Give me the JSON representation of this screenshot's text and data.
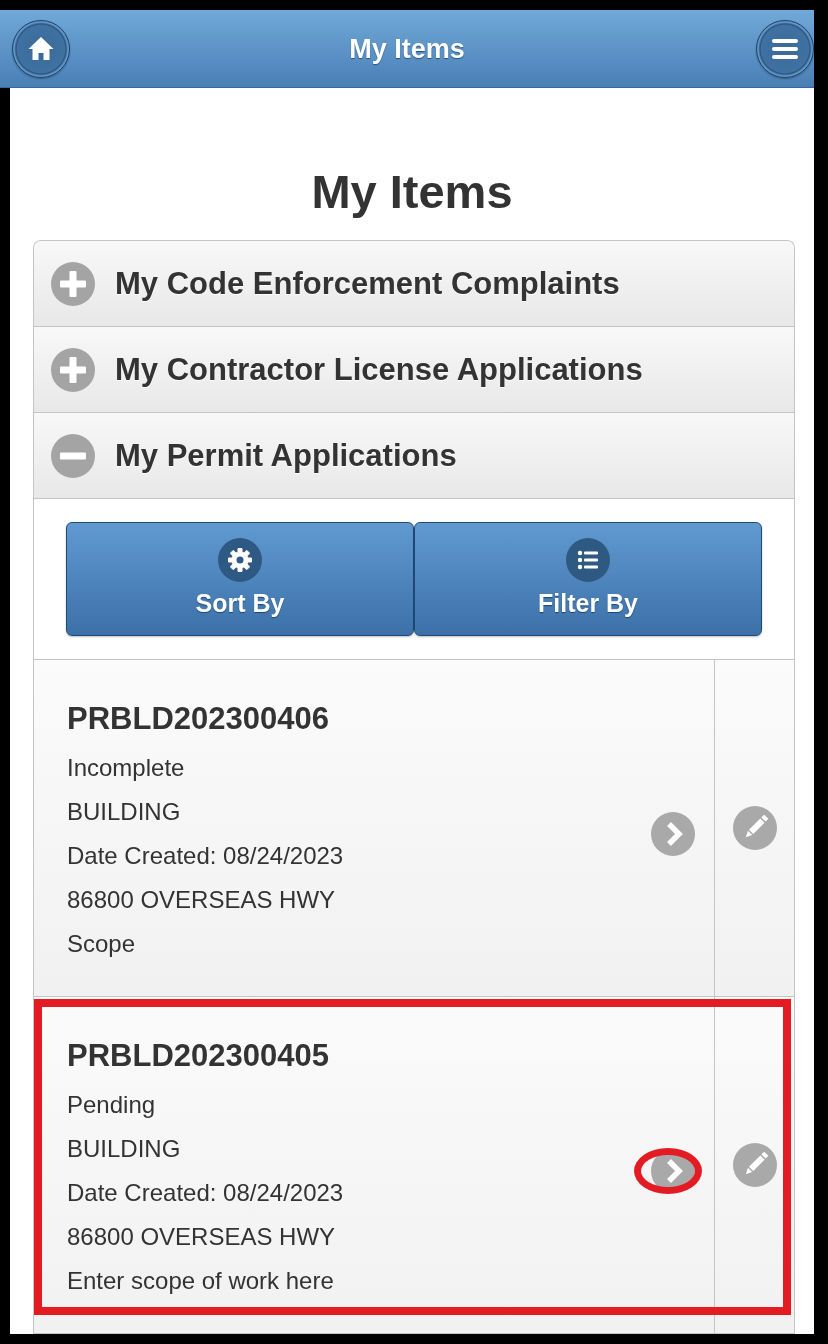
{
  "header": {
    "title": "My Items"
  },
  "page_title": "My Items",
  "sections": [
    {
      "title": "My Code Enforcement Complaints",
      "expanded": false
    },
    {
      "title": "My Contractor License Applications",
      "expanded": false
    },
    {
      "title": "My Permit Applications",
      "expanded": true,
      "actions": [
        {
          "label": "Sort By",
          "kind": "sort"
        },
        {
          "label": "Filter By",
          "kind": "filter"
        }
      ],
      "items": [
        {
          "number": "PRBLD202300406",
          "status": "Incomplete",
          "type": "BUILDING",
          "date": "Date Created: 08/24/2023",
          "address": "86800 OVERSEAS HWY",
          "scope": "Scope",
          "highlighted": false
        },
        {
          "number": "PRBLD202300405",
          "status": "Pending",
          "type": "BUILDING",
          "date": "Date Created: 08/24/2023",
          "address": "86800 OVERSEAS HWY",
          "scope": "Enter scope of work here",
          "highlighted": true
        }
      ]
    }
  ]
}
